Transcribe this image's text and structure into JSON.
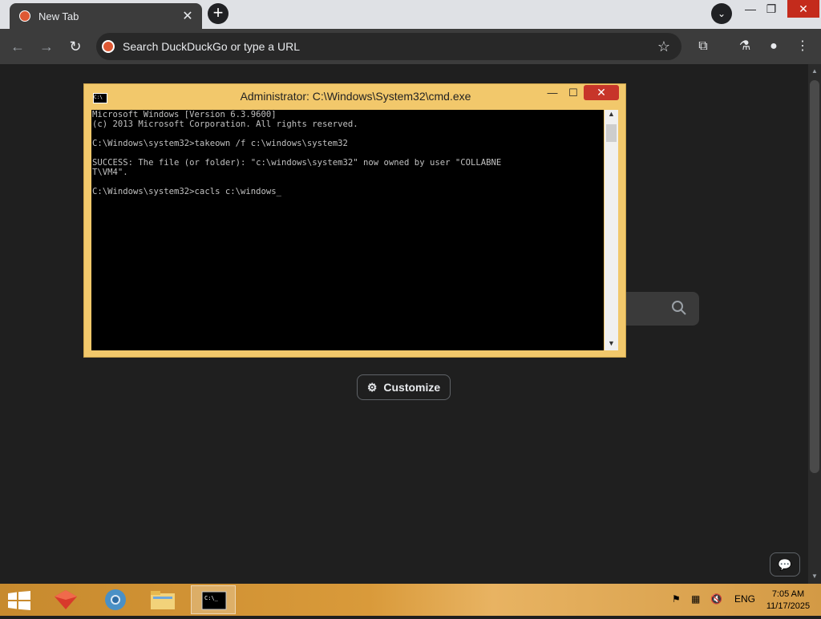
{
  "browser": {
    "tab_title": "New Tab",
    "omnibox_placeholder": "Search DuckDuckGo or type a URL",
    "accent": "#de5833"
  },
  "page": {
    "customize_label": "Customize"
  },
  "cmd_window": {
    "title": "Administrator: C:\\Windows\\System32\\cmd.exe",
    "lines": [
      "Microsoft Windows [Version 6.3.9600]",
      "(c) 2013 Microsoft Corporation. All rights reserved.",
      "",
      "C:\\Windows\\system32>takeown /f c:\\windows\\system32",
      "",
      "SUCCESS: The file (or folder): \"c:\\windows\\system32\" now owned by user \"COLLABNE",
      "T\\VM4\".",
      "",
      "C:\\Windows\\system32>cacls c:\\windows"
    ]
  },
  "taskbar": {
    "language": "ENG",
    "time": "7:05 AM",
    "date": "11/17/2025"
  }
}
